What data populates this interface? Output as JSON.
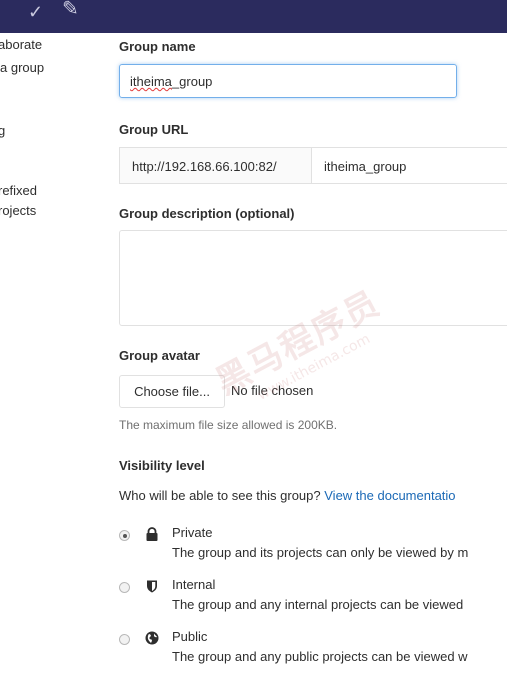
{
  "sidebar": {
    "lines": [
      "aborate",
      "a group",
      "g",
      "refixed",
      "rojects"
    ]
  },
  "form": {
    "group_name": {
      "label": "Group name",
      "value_main": "itheima",
      "value_rest": "_group"
    },
    "group_url": {
      "label": "Group URL",
      "prefix": "http://192.168.66.100:82/",
      "path": "itheima_group"
    },
    "description": {
      "label": "Group description (optional)",
      "value": ""
    },
    "avatar": {
      "label": "Group avatar",
      "button_label": "Choose file...",
      "file_status": "No file chosen",
      "help": "The maximum file size allowed is 200KB."
    },
    "visibility": {
      "label": "Visibility level",
      "question": "Who will be able to see this group?",
      "doc_link": "View the documentatio",
      "options": [
        {
          "title": "Private",
          "description": "The group and its projects can only be viewed by m",
          "icon": "lock-icon",
          "checked": true
        },
        {
          "title": "Internal",
          "description": "The group and any internal projects can be viewed",
          "icon": "shield-icon",
          "checked": false
        },
        {
          "title": "Public",
          "description": "The group and any public projects can be viewed w",
          "icon": "globe-icon",
          "checked": false
        }
      ]
    }
  },
  "watermark": {
    "text": "黑马程序员",
    "url": "www.itheima.com",
    "tm": "TM"
  },
  "colors": {
    "topbar": "#2b2b5e",
    "link": "#1b69b6",
    "focus_border": "#73afea"
  }
}
